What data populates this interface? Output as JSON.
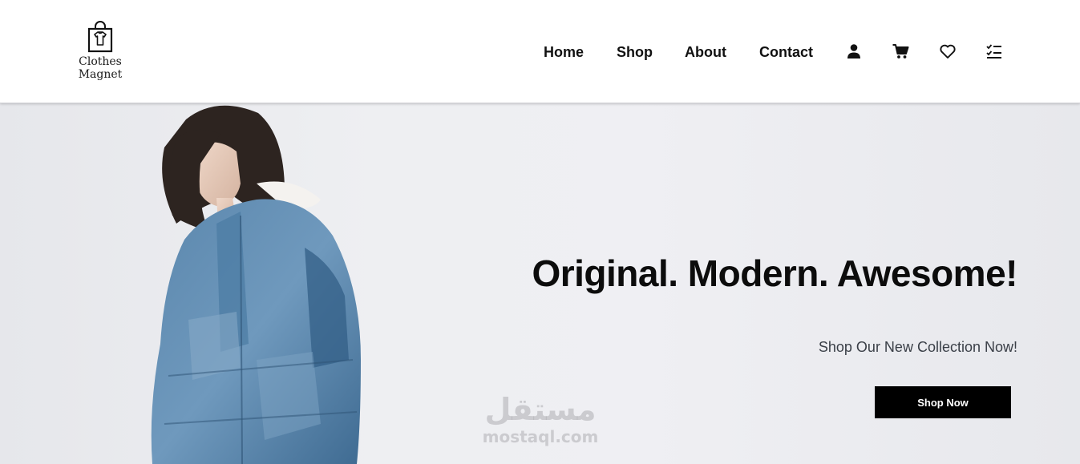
{
  "header": {
    "logo": {
      "line1": "Clothes",
      "line2": "Magnet",
      "icon": "shopping-bag-shirt-icon"
    },
    "nav": [
      {
        "label": "Home"
      },
      {
        "label": "Shop"
      },
      {
        "label": "About"
      },
      {
        "label": "Contact"
      }
    ],
    "icons": [
      "user-icon",
      "cart-icon",
      "heart-icon",
      "checklist-icon"
    ]
  },
  "hero": {
    "headline": "Original. Modern. Awesome!",
    "subline": "Shop Our New Collection Now!",
    "cta_label": "Shop Now",
    "image": "model-in-denim-puffer-jacket"
  },
  "watermark": {
    "arabic": "مستقل",
    "latin": "mostaql.com"
  },
  "colors": {
    "cta_bg": "#000000",
    "hero_bg": "#ececf0",
    "text": "#111111"
  }
}
